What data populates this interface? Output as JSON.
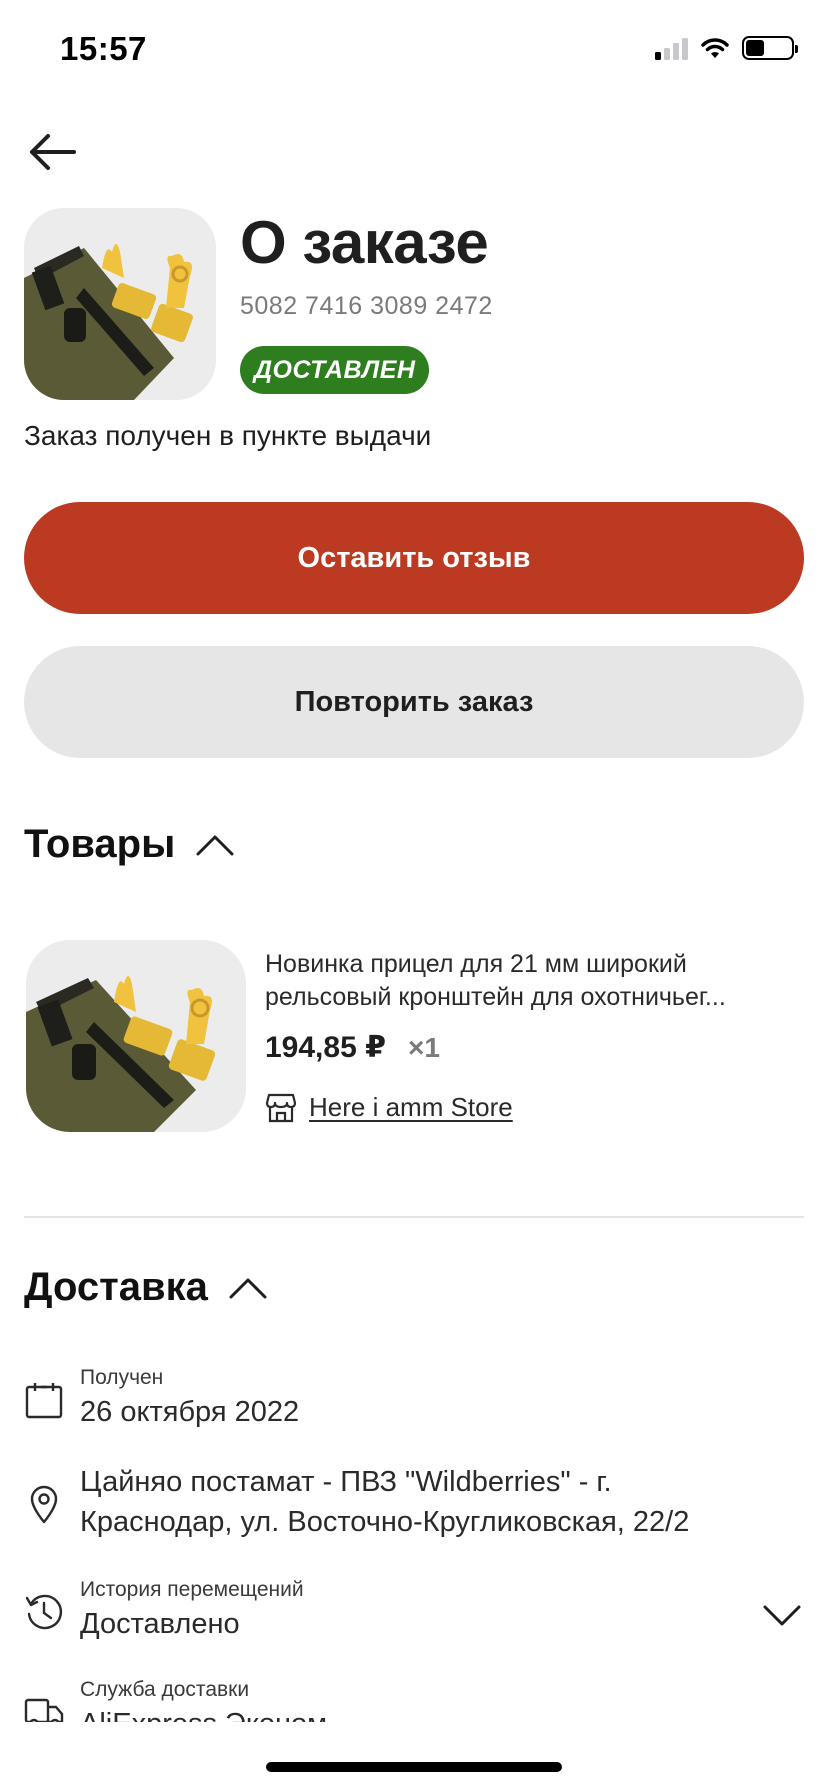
{
  "status_bar": {
    "time": "15:57",
    "battery_level": 0.4
  },
  "header": {
    "title": "О заказе",
    "order_number": "5082 7416 3089 2472",
    "status_badge": "ДОСТАВЛЕН",
    "status_color": "#2e7d1f",
    "subtitle": "Заказ получен в пункте выдачи"
  },
  "actions": {
    "review_label": "Оставить отзыв",
    "repeat_label": "Повторить заказ",
    "primary_color": "#bc3a21"
  },
  "goods": {
    "title": "Товары",
    "items": [
      {
        "title_line1": "Новинка прицел для 21 мм широкий",
        "title_line2": "рельсовый кронштейн для охотничьег...",
        "price": "194,85 ₽",
        "qty": "×1",
        "store": "Here i amm Store"
      }
    ]
  },
  "delivery": {
    "title": "Доставка",
    "received_label": "Получен",
    "received_date": "26 октября 2022",
    "address_line1": "Цайняо постамат - ПВЗ \"Wildberries\" - г.",
    "address_line2": "Краснодар, ул. Восточно-Кругликовская, 22/2",
    "history_label": "История перемещений",
    "history_value": "Доставлено",
    "service_label": "Служба доставки",
    "service_value": "AliExpress Эконом"
  }
}
